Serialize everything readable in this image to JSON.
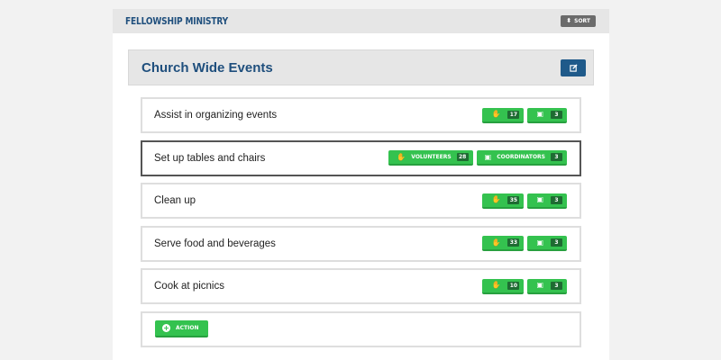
{
  "header": {
    "title": "FELLOWSHIP MINISTRY",
    "sort_label": "SORT",
    "sort_icon": "sort-icon"
  },
  "section": {
    "title": "Church Wide Events",
    "edit_icon": "edit-icon"
  },
  "items": [
    {
      "label": "Assist in organizing events",
      "volunteers": "17",
      "coordinators": "3"
    },
    {
      "label": "Set up tables and chairs",
      "volunteers_label": "VOLUNTEERS",
      "volunteers": "28",
      "coordinators_label": "COORDINATORS",
      "coordinators": "3",
      "selected": true
    },
    {
      "label": "Clean up",
      "volunteers": "35",
      "coordinators": "3"
    },
    {
      "label": "Serve food and beverages",
      "volunteers": "33",
      "coordinators": "3"
    },
    {
      "label": "Cook at picnics",
      "volunteers": "10",
      "coordinators": "3"
    }
  ],
  "action": {
    "label": "ACTION",
    "icon": "plus-circle-icon"
  },
  "colors": {
    "brand_blue": "#1f4f7d",
    "edit_button": "#1f5a8a",
    "green": "#34c24f",
    "count_bg": "#1e6b32"
  }
}
